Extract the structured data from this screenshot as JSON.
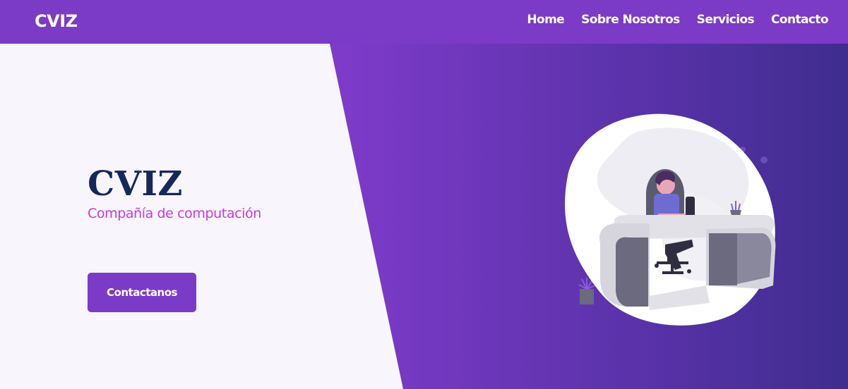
{
  "navbar": {
    "brand": "CVIZ",
    "links": [
      {
        "label": "Home"
      },
      {
        "label": "Sobre Nosotros"
      },
      {
        "label": "Servicios"
      },
      {
        "label": "Contacto"
      }
    ]
  },
  "hero": {
    "title": "CVIZ",
    "subtitle": "Compañía de computación",
    "button_label": "Contactanos",
    "illustration_icon": "person-at-desk-illustration"
  },
  "colors": {
    "primary": "#7b3bc6",
    "title": "#14285c",
    "subtitle": "#c43be0",
    "background": "#f9f5fc"
  }
}
